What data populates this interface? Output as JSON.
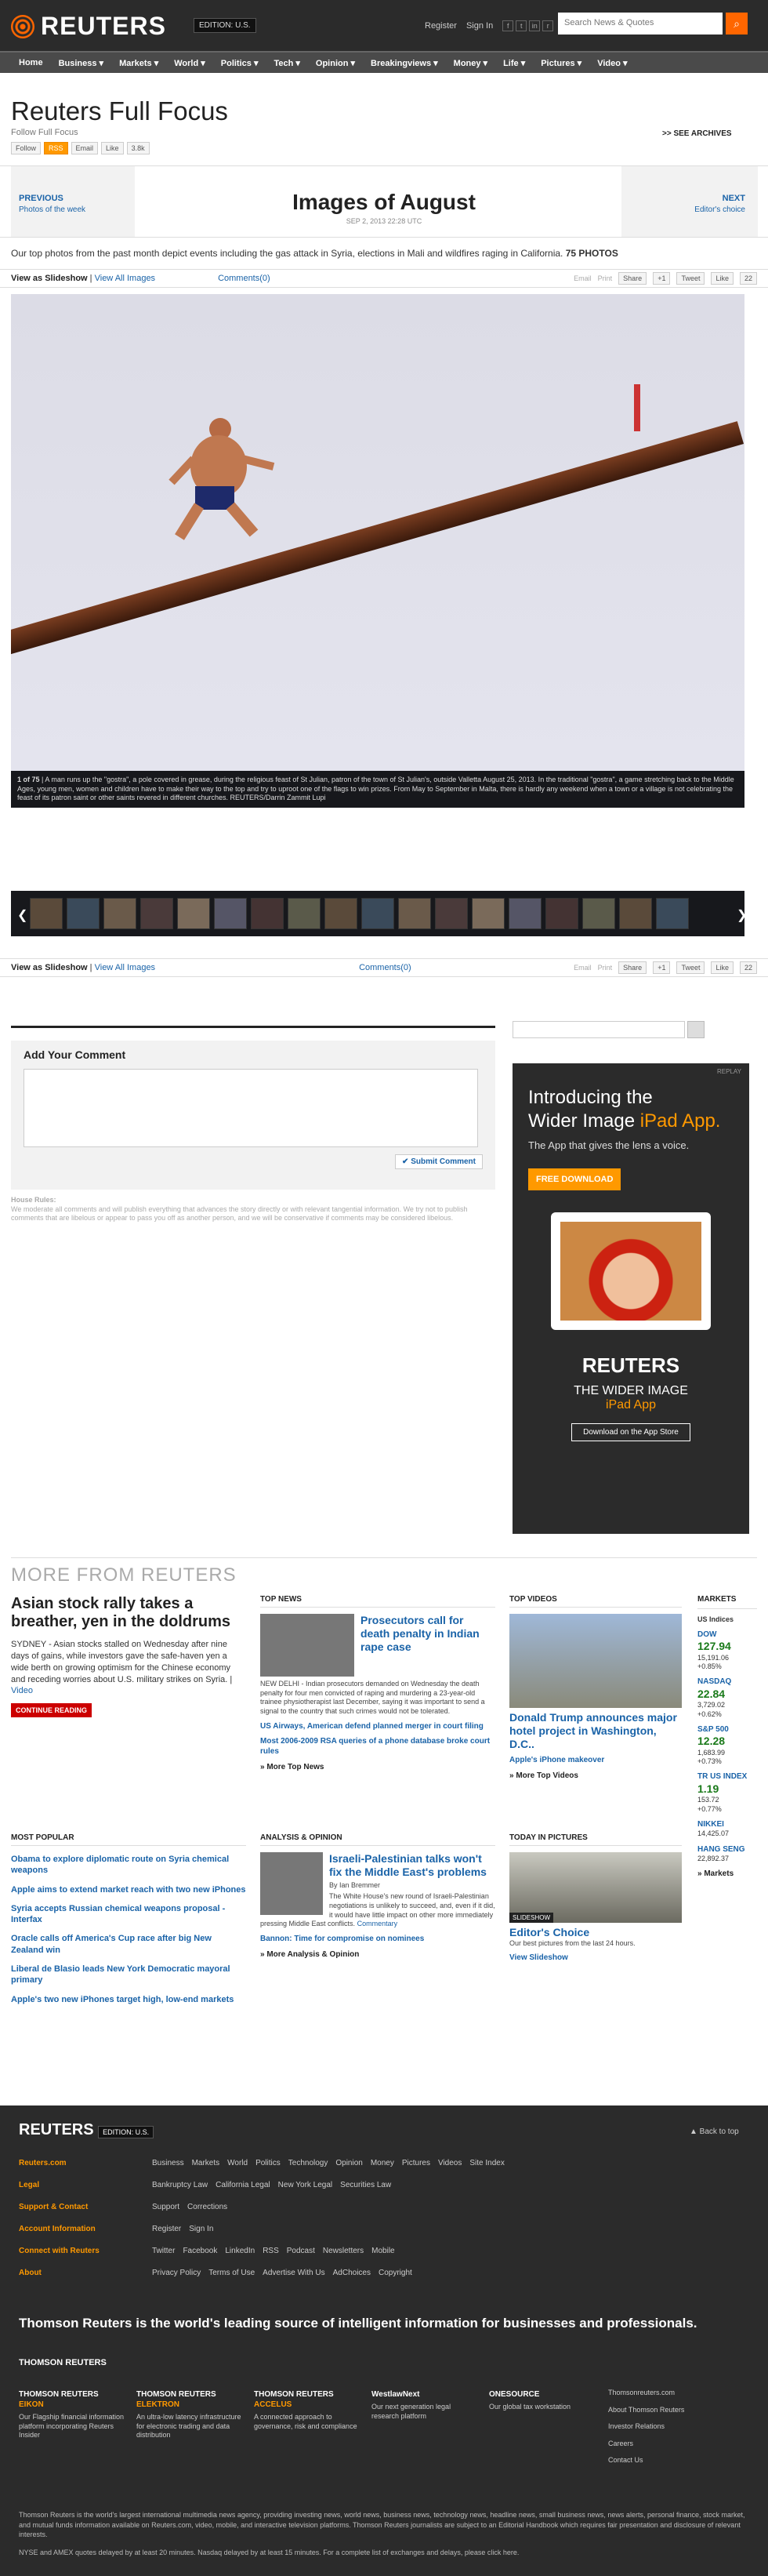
{
  "header": {
    "logo": "REUTERS",
    "edition": "EDITION: U.S.",
    "register": "Register",
    "signin": "Sign In",
    "search_placeholder": "Search News & Quotes"
  },
  "nav": [
    "Home",
    "Business ▾",
    "Markets ▾",
    "World ▾",
    "Politics ▾",
    "Tech ▾",
    "Opinion ▾",
    "Breakingviews ▾",
    "Money ▾",
    "Life ▾",
    "Pictures ▾",
    "Video ▾"
  ],
  "page": {
    "title": "Reuters Full Focus",
    "follow": "Follow Full Focus",
    "see_archives": ">> SEE ARCHIVES",
    "follow_btn": "Follow",
    "rss_btn": "RSS",
    "email_btn": "Email",
    "like_btn": "Like",
    "like_count": "3.8k"
  },
  "gallery": {
    "prev": "PREVIOUS",
    "prev_sub": "Photos of the week",
    "next": "NEXT",
    "next_sub": "Editor's choice",
    "title": "Images of August",
    "date": "SEP 2, 2013  22:28 UTC",
    "desc": "Our top photos from the past month depict events including the gas attack in Syria, elections in Mali and wildfires raging in California. ",
    "count": "75 PHOTOS",
    "view_slideshow": "View as Slideshow",
    "view_all": "View All Images",
    "comments": "Comments(0)",
    "email": "Email",
    "print": "Print",
    "share": "Share",
    "plus": "+1",
    "tweet": "Tweet",
    "like": "Like",
    "like_count": "22",
    "caption_num": "1 of 75",
    "caption": "A man runs up the \"gostra\", a pole covered in grease, during the religious feast of St Julian, patron of the town of St Julian's, outside Valletta August 25, 2013. In the traditional \"gostra\", a game stretching back to the Middle Ages, young men, women and children have to make their way to the top and try to uproot one of the flags to win prizes. From May to September in Malta, there is hardly any weekend when a town or a village is not celebrating the feast of its patron saint or other saints revered in different churches.",
    "credit": "REUTERS/Darrin Zammit Lupi"
  },
  "comment": {
    "title": "Add Your Comment",
    "submit": "Submit Comment",
    "rules_h": "House Rules:",
    "rules": "We moderate all comments and will publish everything that advances the story directly or with relevant tangential information. We try not to publish comments that are libelous or appear to pass you off as another person, and we will be conservative if comments may be considered libelous."
  },
  "ad": {
    "replay": "REPLAY",
    "line1": "Introducing the",
    "line2": "Wider Image",
    "line3": "iPad App.",
    "sub": "The App that gives the lens a voice.",
    "download": "FREE DOWNLOAD",
    "logo": "REUTERS",
    "wi": "THE WIDER IMAGE",
    "app": "iPad App",
    "store": "Download on the App Store"
  },
  "more": {
    "title": "MORE FROM REUTERS",
    "lead_title": "Asian stock rally takes a breather, yen in the doldrums",
    "lead_text": "SYDNEY - Asian stocks stalled on Wednesday after nine days of gains, while investors gave the safe-haven yen a wide berth on growing optimism for the Chinese economy and receding worries about U.S. military strikes on Syria.",
    "video": "Video",
    "continue": "CONTINUE READING",
    "top_news": "TOP NEWS",
    "tn_title": "Prosecutors call for death penalty in Indian rape case",
    "tn_text": "NEW DELHI - Indian prosecutors demanded on Wednesday the death penalty for four men convicted of raping and murdering a 23-year-old trainee physiotherapist last December, saying it was important to send a signal to the country that such crimes would not be tolerated.",
    "tn_l1": "US Airways, American defend planned merger in court filing",
    "tn_l2": "Most 2006-2009 RSA queries of a phone database broke court rules",
    "tn_more": "» More Top News",
    "top_videos": "TOP VIDEOS",
    "tv_title": "Donald Trump announces major hotel project in Washington, D.C..",
    "tv_l1": "Apple's iPhone makeover",
    "tv_more": "» More Top Videos",
    "markets": "MARKETS",
    "us_indices": "US Indices",
    "m": [
      {
        "n": "DOW",
        "v": "127.94",
        "a": "15,191.06",
        "p": "+0.85%"
      },
      {
        "n": "NASDAQ",
        "v": "22.84",
        "a": "3,729.02",
        "p": "+0.62%"
      },
      {
        "n": "S&P 500",
        "v": "12.28",
        "a": "1,683.99",
        "p": "+0.73%"
      },
      {
        "n": "TR US INDEX",
        "v": "1.19",
        "a": "153.72",
        "p": "+0.77%"
      },
      {
        "n": "NIKKEI",
        "v": "",
        "a": "14,425.07",
        "p": ""
      },
      {
        "n": "HANG SENG",
        "v": "",
        "a": "22,892.37",
        "p": ""
      }
    ],
    "mk_more": "» Markets",
    "popular": "MOST POPULAR",
    "pop": [
      "Obama to explore diplomatic route on Syria chemical weapons",
      "Apple aims to extend market reach with two new iPhones",
      "Syria accepts Russian chemical weapons proposal - Interfax",
      "Oracle calls off America's Cup race after big New Zealand win",
      "Liberal de Blasio leads New York Democratic mayoral primary",
      "Apple's two new iPhones target high, low-end markets"
    ],
    "analysis": "ANALYSIS & OPINION",
    "an_title": "Israeli-Palestinian talks won't fix the Middle East's problems",
    "an_by": "By Ian Bremmer",
    "an_text": "The White House's new round of Israeli-Palestinian negotiations is unlikely to succeed, and, even if it did, it would have little impact on other more immediately pressing Middle East conflicts.",
    "an_c": "Commentary",
    "an_l1": "Bannon: Time for compromise on nominees",
    "an_more": "» More Analysis & Opinion",
    "pictures": "TODAY IN PICTURES",
    "pic_title": "Editor's Choice",
    "pic_text": "Our best pictures from the last 24 hours.",
    "pic_link": "View Slideshow",
    "slideshow": "SLIDESHOW"
  },
  "footer": {
    "back": "▲ Back to top",
    "rows": [
      {
        "h": "Reuters.com",
        "items": [
          "Business",
          "Markets",
          "World",
          "Politics",
          "Technology",
          "Opinion",
          "Money",
          "Pictures",
          "Videos",
          "Site Index"
        ]
      },
      {
        "h": "Legal",
        "items": [
          "Bankruptcy Law",
          "California Legal",
          "New York Legal",
          "Securities Law"
        ]
      },
      {
        "h": "Support & Contact",
        "items": [
          "Support",
          "Corrections"
        ]
      },
      {
        "h": "Account Information",
        "items": [
          "Register",
          "Sign In"
        ]
      },
      {
        "h": "Connect with Reuters",
        "items": [
          "Twitter",
          "Facebook",
          "LinkedIn",
          "RSS",
          "Podcast",
          "Newsletters",
          "Mobile"
        ]
      },
      {
        "h": "About",
        "items": [
          "Privacy Policy",
          "Terms of Use",
          "Advertise With Us",
          "AdChoices",
          "Copyright"
        ]
      }
    ],
    "tagline": "Thomson Reuters is the world's leading source of intelligent information for businesses and professionals.",
    "tr_logo": "THOMSON REUTERS",
    "biz": [
      {
        "h": "THOMSON REUTERS",
        "e": "EIKON",
        "t": "Our Flagship financial information platform incorporating Reuters Insider"
      },
      {
        "h": "THOMSON REUTERS",
        "e": "ELEKTRON",
        "t": "An ultra-low latency infrastructure for electronic trading and data distribution"
      },
      {
        "h": "THOMSON REUTERS",
        "e": "ACCELUS",
        "t": "A connected approach to governance, risk and compliance"
      },
      {
        "h": "WestlawNext",
        "e": "",
        "t": "Our next generation legal research platform"
      },
      {
        "h": "ONESOURCE",
        "e": "",
        "t": "Our global tax workstation"
      }
    ],
    "links": [
      "Thomsonreuters.com",
      "About Thomson Reuters",
      "Investor Relations",
      "Careers",
      "Contact Us"
    ],
    "legal": "Thomson Reuters is the world's largest international multimedia news agency, providing investing news, world news, business news, technology news, headline news, small business news, news alerts, personal finance, stock market, and mutual funds information available on Reuters.com, video, mobile, and interactive television platforms. Thomson Reuters journalists are subject to an Editorial Handbook which requires fair presentation and disclosure of relevant interests.",
    "legal2": "NYSE and AMEX quotes delayed by at least 20 minutes. Nasdaq delayed by at least 15 minutes. For a complete list of exchanges and delays, please click here."
  }
}
